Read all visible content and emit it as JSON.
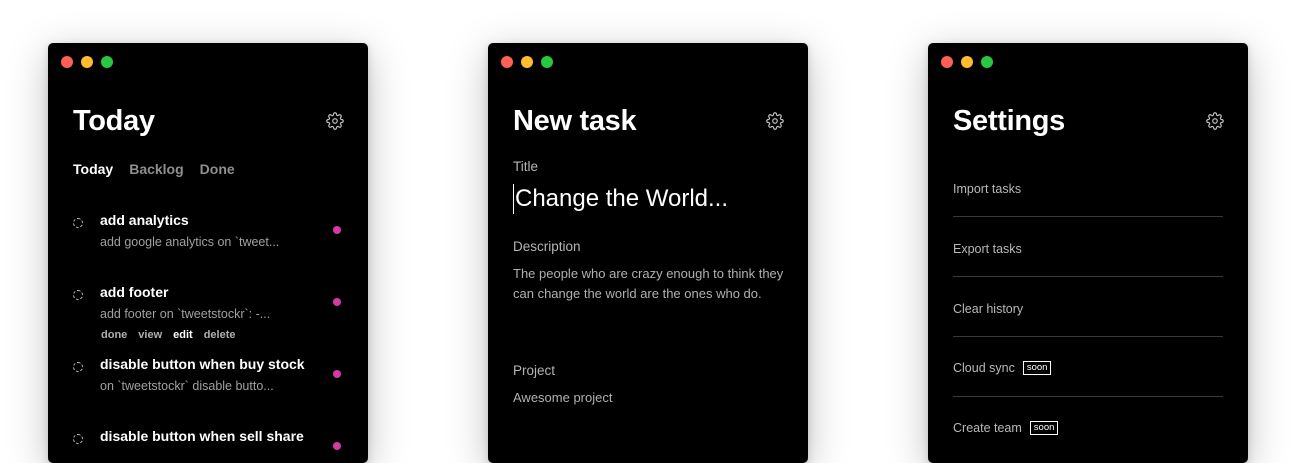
{
  "colors": {
    "window_bg": "#000000",
    "page_bg": "#ffffff",
    "traffic_red": "#ff5f57",
    "traffic_yellow": "#febc2e",
    "traffic_green": "#28c840",
    "project_dot": "#d63aa0"
  },
  "today": {
    "title": "Today",
    "tabs": [
      {
        "label": "Today",
        "active": true
      },
      {
        "label": "Backlog",
        "active": false
      },
      {
        "label": "Done",
        "active": false
      }
    ],
    "tasks": [
      {
        "title": "add analytics",
        "description": "add google analytics on `tweet..."
      },
      {
        "title": "add footer",
        "description": "add footer on `tweetstockr`: -..."
      },
      {
        "title": "disable button when buy stock",
        "description": "on `tweetstockr` disable butto..."
      },
      {
        "title": "disable button when sell share",
        "description": ""
      }
    ],
    "actions": [
      {
        "label": "done"
      },
      {
        "label": "view"
      },
      {
        "label": "edit"
      },
      {
        "label": "delete"
      }
    ]
  },
  "new_task": {
    "title": "New task",
    "title_label": "Title",
    "title_placeholder": "Change the World...",
    "description_label": "Description",
    "description_value": "The people who are crazy enough to think they can change the world are the ones who do.",
    "project_label": "Project",
    "project_value": "Awesome project"
  },
  "settings": {
    "title": "Settings",
    "items": [
      {
        "label": "Import tasks",
        "badge": ""
      },
      {
        "label": "Export tasks",
        "badge": ""
      },
      {
        "label": "Clear history",
        "badge": ""
      },
      {
        "label": "Cloud sync",
        "badge": "soon"
      },
      {
        "label": "Create team",
        "badge": "soon"
      }
    ]
  },
  "icons": {
    "settings": "gear-icon",
    "task_checkbox": "circle-dashed-icon",
    "project_indicator": "dot-icon"
  }
}
